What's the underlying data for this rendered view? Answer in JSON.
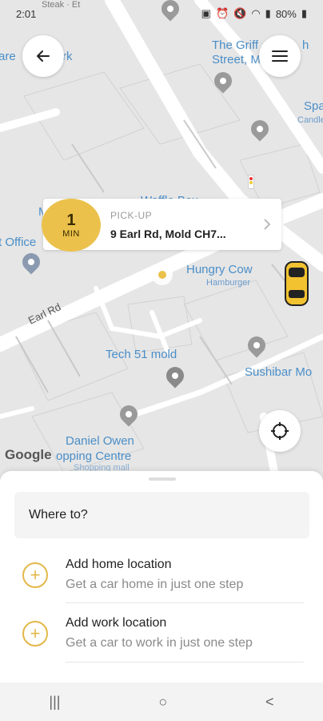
{
  "status_bar": {
    "time": "2:01",
    "battery": "80%"
  },
  "map": {
    "labels": {
      "steak": "Steak · Et",
      "area_top_left": "are",
      "area_top_left2": "rk",
      "griff": "The Griff",
      "griff2": "h",
      "street": "Street, M",
      "spa": "Spa",
      "candle": "Candle",
      "waffle": "Waffle Box",
      "m_left": "M",
      "office": "t Office",
      "hungry_cow": "Hungry Cow",
      "hamburger": "Hamburger",
      "earl_rd": "Earl Rd",
      "tech51": "Tech 51 mold",
      "sushibar": "Sushibar Mo",
      "daniel_owen": "Daniel Owen",
      "shopping": "opping Centre",
      "shopping_mall": "Shopping mall",
      "google": "Google"
    }
  },
  "pickup": {
    "eta_value": "1",
    "eta_unit": "MIN",
    "label": "PICK-UP",
    "address": "9 Earl Rd, Mold CH7..."
  },
  "sheet": {
    "search_placeholder": "Where to?",
    "home": {
      "title": "Add home location",
      "subtitle": "Get a car home in just one step"
    },
    "work": {
      "title": "Add work location",
      "subtitle": "Get a car to work in just one step"
    }
  },
  "nav_bar": {
    "recent": "|||",
    "home": "○",
    "back": "<"
  },
  "colors": {
    "accent": "#ebc14b",
    "map_bg": "#e6e6e6",
    "map_label": "#4a8ec8"
  }
}
